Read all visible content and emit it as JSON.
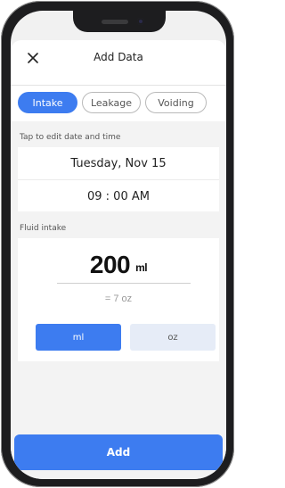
{
  "header": {
    "title": "Add Data",
    "close_icon": "close-icon"
  },
  "tabs": [
    {
      "label": "Intake",
      "active": true
    },
    {
      "label": "Leakage",
      "active": false
    },
    {
      "label": "Voiding",
      "active": false
    }
  ],
  "datetime": {
    "section_label": "Tap to edit date and time",
    "date": "Tuesday, Nov 15",
    "time": "09 : 00 AM"
  },
  "fluid": {
    "section_label": "Fluid intake",
    "amount": "200",
    "amount_unit": "ml",
    "converted": "= 7 oz",
    "units": [
      {
        "label": "ml",
        "active": true
      },
      {
        "label": "oz",
        "active": false
      }
    ]
  },
  "actions": {
    "add_label": "Add"
  },
  "colors": {
    "accent": "#3d7cf0",
    "inactive_unit_bg": "#e6ecf7",
    "sheet_bg": "#f3f3f3"
  }
}
